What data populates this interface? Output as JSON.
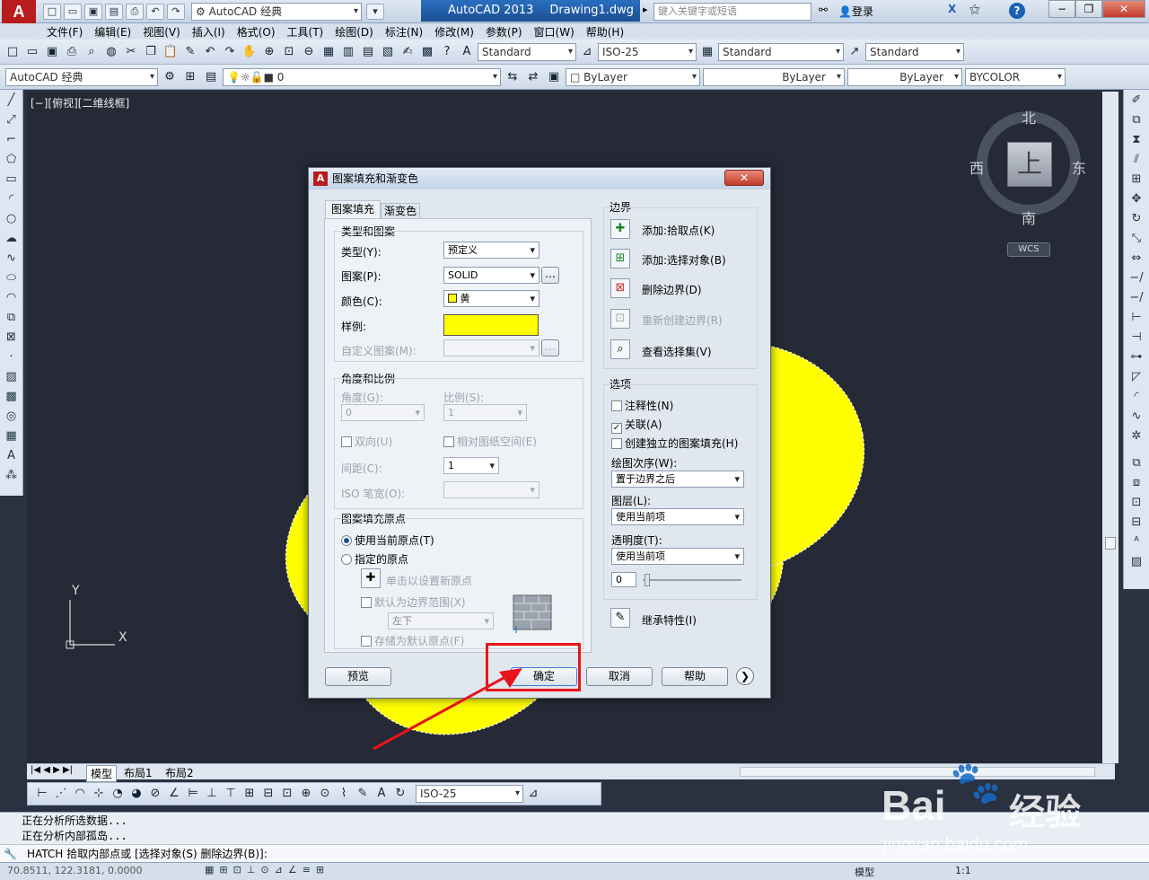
{
  "titlebar": {
    "logo": "A",
    "workspace": "AutoCAD 经典",
    "app_title": "AutoCAD 2013",
    "file_name": "Drawing1.dwg",
    "search_placeholder": "键入关键字或短语",
    "login": "登录"
  },
  "menu": [
    "文件(F)",
    "编辑(E)",
    "视图(V)",
    "插入(I)",
    "格式(O)",
    "工具(T)",
    "绘图(D)",
    "标注(N)",
    "修改(M)",
    "参数(P)",
    "窗口(W)",
    "帮助(H)"
  ],
  "toolbar1": {
    "text_style": "Standard",
    "dim_style": "ISO-25",
    "table_style": "Standard",
    "mleader_style": "Standard"
  },
  "toolbar2": {
    "workspace": "AutoCAD 经典",
    "layer": "0",
    "color": "ByLayer",
    "linetype": "ByLayer",
    "lineweight": "ByLayer",
    "plotstyle": "BYCOLOR"
  },
  "canvas": {
    "view_label": "[−][俯视][二维线框]",
    "fill_color": "#ffff00",
    "ucs_x": "X",
    "ucs_y": "Y"
  },
  "viewcube": {
    "north": "北",
    "south": "南",
    "east": "东",
    "west": "西",
    "top": "上",
    "wcs": "WCS"
  },
  "dialog": {
    "title": "图案填充和渐变色",
    "tabs": [
      "图案填充",
      "渐变色"
    ],
    "type_pattern": {
      "title": "类型和图案",
      "type_label": "类型(Y):",
      "type_value": "预定义",
      "pattern_label": "图案(P):",
      "pattern_value": "SOLID",
      "color_label": "颜色(C):",
      "color_value": "黄",
      "swatch_label": "样例:",
      "custom_label": "自定义图案(M):"
    },
    "angle_scale": {
      "title": "角度和比例",
      "angle_label": "角度(G):",
      "angle_value": "0",
      "scale_label": "比例(S):",
      "scale_value": "1",
      "double_label": "双向(U)",
      "relative_label": "相对图纸空间(E)",
      "spacing_label": "间距(C):",
      "spacing_value": "1",
      "iso_label": "ISO 笔宽(O):"
    },
    "origin": {
      "title": "图案填充原点",
      "use_current": "使用当前原点(T)",
      "specified": "指定的原点",
      "click_set": "单击以设置新原点",
      "default_boundary": "默认为边界范围(X)",
      "position": "左下",
      "store_default": "存储为默认原点(F)"
    },
    "boundary": {
      "title": "边界",
      "add_pick": "添加:拾取点(K)",
      "add_select": "添加:选择对象(B)",
      "remove": "删除边界(D)",
      "recreate": "重新创建边界(R)",
      "view_set": "查看选择集(V)"
    },
    "options": {
      "title": "选项",
      "annotative": "注释性(N)",
      "associative": "关联(A)",
      "independent": "创建独立的图案填充(H)",
      "draw_order_label": "绘图次序(W):",
      "draw_order_value": "置于边界之后",
      "layer_label": "图层(L):",
      "layer_value": "使用当前项",
      "transparency_label": "透明度(T):",
      "transparency_value": "使用当前项",
      "transparency_num": "0"
    },
    "inherit": "继承特性(I)",
    "buttons": {
      "preview": "预览",
      "ok": "确定",
      "cancel": "取消",
      "help": "帮助"
    }
  },
  "layout_tabs": [
    "模型",
    "布局1",
    "布局2"
  ],
  "status_toolbar": {
    "dim_style": "ISO-25"
  },
  "command": {
    "history": [
      "正在分析所选数据...",
      "正在分析内部孤岛..."
    ],
    "prompt": "HATCH 拾取内部点或 [选择对象(S) 删除边界(B)]:"
  },
  "statusbar": {
    "coords": "70.8511, 122.3181, 0.0000",
    "model": "模型",
    "scale": "1:1"
  },
  "watermark": {
    "brand": "Bai",
    "brand2": "经验",
    "url": "jingyan.baidu.com"
  }
}
